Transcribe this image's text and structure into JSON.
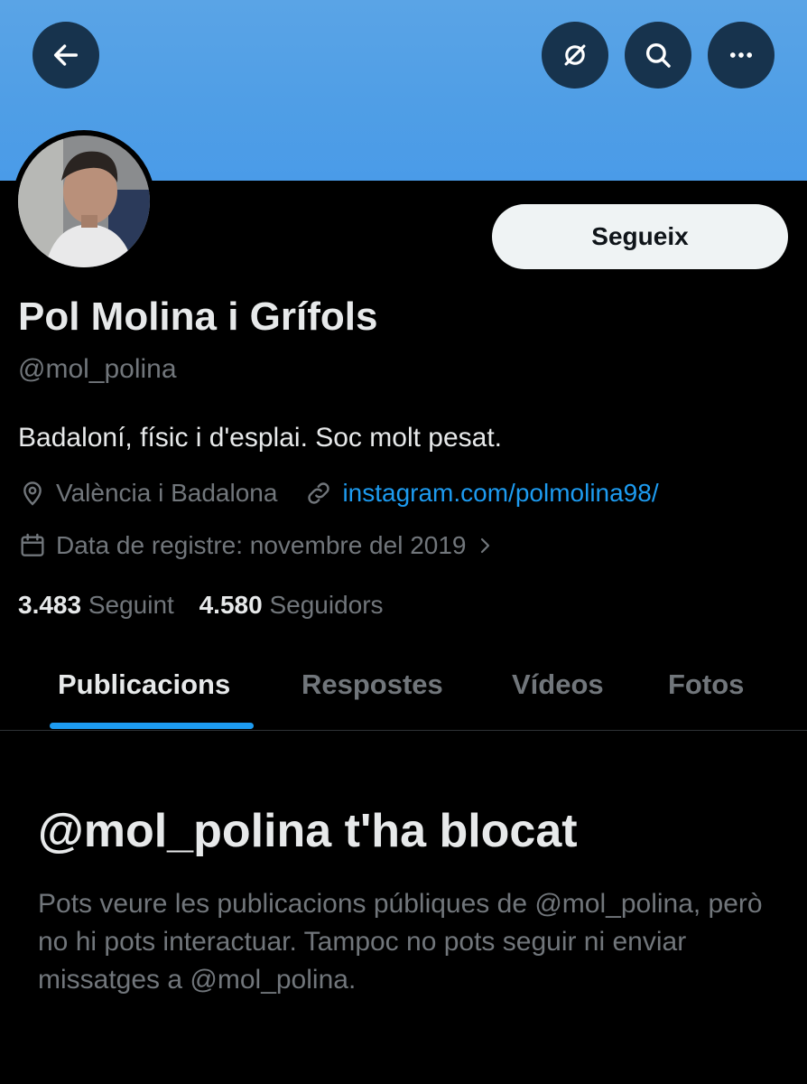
{
  "header": {
    "back_icon": "arrow-left-icon",
    "actions": [
      "dismiss-icon",
      "search-icon",
      "more-icon"
    ]
  },
  "profile": {
    "name": "Pol Molina i Grífols",
    "handle": "@mol_polina",
    "bio": "Badaloní, físic i d'esplai. Soc molt pesat.",
    "location": "València i Badalona",
    "website": "instagram.com/polmolina98/",
    "joined": "Data de registre: novembre del 2019",
    "follow_label": "Segueix",
    "following_count": "3.483",
    "following_label": "Seguint",
    "followers_count": "4.580",
    "followers_label": "Seguidors"
  },
  "tabs": [
    {
      "label": "Publicacions",
      "active": true
    },
    {
      "label": "Respostes",
      "active": false
    },
    {
      "label": "Vídeos",
      "active": false
    },
    {
      "label": "Fotos",
      "active": false
    }
  ],
  "blocked": {
    "title": "@mol_polina t'ha blocat",
    "message": "Pots veure les publicacions públiques de @mol_polina, però no hi pots interactuar. Tampoc no pots seguir ni enviar missatges a @mol_polina."
  },
  "colors": {
    "accent": "#1d9bf0",
    "banner": "#4f9ee6",
    "background": "#000000",
    "muted_text": "#71767b"
  }
}
